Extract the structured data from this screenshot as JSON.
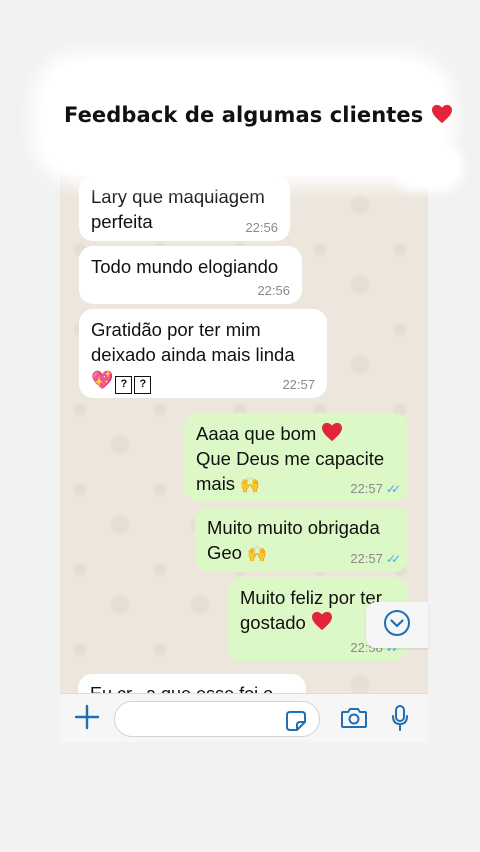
{
  "header": {
    "title": "Feedback de algumas clientes",
    "title_emoji": "red-heart-icon"
  },
  "messages": [
    {
      "direction": "in",
      "text": "Lary que maquiagem\nperfeita",
      "time": "22:56"
    },
    {
      "direction": "in",
      "text": "Todo mundo elogiando",
      "time": "22:56"
    },
    {
      "direction": "in",
      "text_line1": "Gratidão por ter mim",
      "text_line2": "deixado ainda mais linda",
      "time": "22:57",
      "emojis": [
        "sparkling-heart-icon",
        "?",
        "?"
      ]
    },
    {
      "direction": "out",
      "text_line1": "Aaaa que bom",
      "text_line2": "Que Deus me capacite",
      "text_line3": "mais",
      "time": "22:57",
      "status": "read"
    },
    {
      "direction": "out",
      "text_line1": "Muito muito obrigada",
      "text_line2": "Geo",
      "time": "22:57",
      "status": "read"
    },
    {
      "direction": "out",
      "text_line1": "Muito feliz por ter",
      "text_line2": "gostado",
      "time": "22:58",
      "status": "read"
    },
    {
      "direction": "in",
      "text": "Eu cr...a  que esse foi o"
    }
  ],
  "composer": {
    "placeholder": ""
  },
  "colors": {
    "incoming": "#ffffff",
    "outgoing": "#dcf8c6",
    "accent": "#1f6fb5",
    "read_ticks": "#4fa9e8"
  }
}
